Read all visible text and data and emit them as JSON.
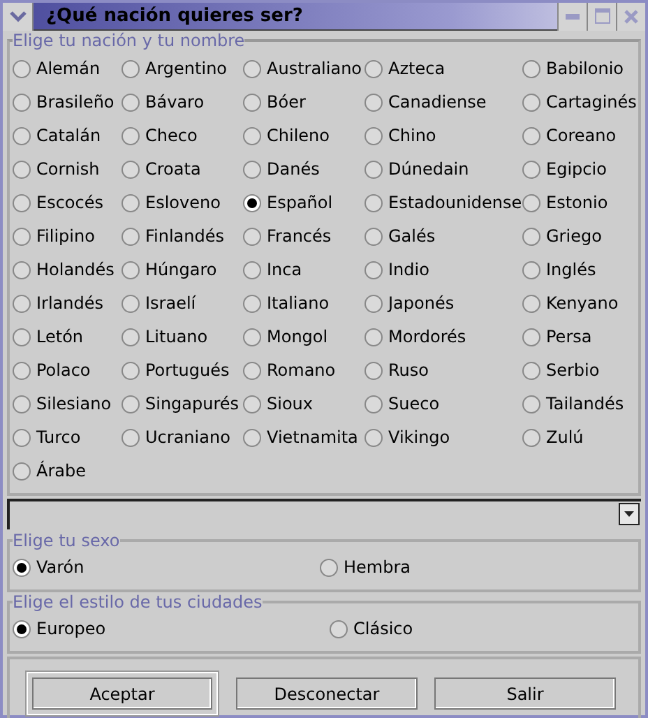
{
  "window": {
    "title": "¿Qué nación quieres ser?"
  },
  "nation_group": {
    "legend": "Elige tu nación y tu nombre",
    "options": [
      {
        "label": "Alemán",
        "selected": false
      },
      {
        "label": "Argentino",
        "selected": false
      },
      {
        "label": "Australiano",
        "selected": false
      },
      {
        "label": "Azteca",
        "selected": false
      },
      {
        "label": "Babilonio",
        "selected": false
      },
      {
        "label": "Brasileño",
        "selected": false
      },
      {
        "label": "Bávaro",
        "selected": false
      },
      {
        "label": "Bóer",
        "selected": false
      },
      {
        "label": "Canadiense",
        "selected": false
      },
      {
        "label": "Cartaginés",
        "selected": false
      },
      {
        "label": "Catalán",
        "selected": false
      },
      {
        "label": "Checo",
        "selected": false
      },
      {
        "label": "Chileno",
        "selected": false
      },
      {
        "label": "Chino",
        "selected": false
      },
      {
        "label": "Coreano",
        "selected": false
      },
      {
        "label": "Cornish",
        "selected": false
      },
      {
        "label": "Croata",
        "selected": false
      },
      {
        "label": "Danés",
        "selected": false
      },
      {
        "label": "Dúnedain",
        "selected": false
      },
      {
        "label": "Egipcio",
        "selected": false
      },
      {
        "label": "Escocés",
        "selected": false
      },
      {
        "label": "Esloveno",
        "selected": false
      },
      {
        "label": "Español",
        "selected": true
      },
      {
        "label": "Estadounidense",
        "selected": false
      },
      {
        "label": "Estonio",
        "selected": false
      },
      {
        "label": "Filipino",
        "selected": false
      },
      {
        "label": "Finlandés",
        "selected": false
      },
      {
        "label": "Francés",
        "selected": false
      },
      {
        "label": "Galés",
        "selected": false
      },
      {
        "label": "Griego",
        "selected": false
      },
      {
        "label": "Holandés",
        "selected": false
      },
      {
        "label": "Húngaro",
        "selected": false
      },
      {
        "label": "Inca",
        "selected": false
      },
      {
        "label": "Indio",
        "selected": false
      },
      {
        "label": "Inglés",
        "selected": false
      },
      {
        "label": "Irlandés",
        "selected": false
      },
      {
        "label": "Israelí",
        "selected": false
      },
      {
        "label": "Italiano",
        "selected": false
      },
      {
        "label": "Japonés",
        "selected": false
      },
      {
        "label": "Kenyano",
        "selected": false
      },
      {
        "label": "Letón",
        "selected": false
      },
      {
        "label": "Lituano",
        "selected": false
      },
      {
        "label": "Mongol",
        "selected": false
      },
      {
        "label": "Mordorés",
        "selected": false
      },
      {
        "label": "Persa",
        "selected": false
      },
      {
        "label": "Polaco",
        "selected": false
      },
      {
        "label": "Portugués",
        "selected": false
      },
      {
        "label": "Romano",
        "selected": false
      },
      {
        "label": "Ruso",
        "selected": false
      },
      {
        "label": "Serbio",
        "selected": false
      },
      {
        "label": "Silesiano",
        "selected": false
      },
      {
        "label": "Singapurés",
        "selected": false
      },
      {
        "label": "Sioux",
        "selected": false
      },
      {
        "label": "Sueco",
        "selected": false
      },
      {
        "label": "Tailandés",
        "selected": false
      },
      {
        "label": "Turco",
        "selected": false
      },
      {
        "label": "Ucraniano",
        "selected": false
      },
      {
        "label": "Vietnamita",
        "selected": false
      },
      {
        "label": "Vikingo",
        "selected": false
      },
      {
        "label": "Zulú",
        "selected": false
      },
      {
        "label": "Árabe",
        "selected": false
      }
    ]
  },
  "sex_group": {
    "legend": "Elige tu sexo",
    "options": [
      {
        "label": "Varón",
        "selected": true
      },
      {
        "label": "Hembra",
        "selected": false
      }
    ]
  },
  "city_group": {
    "legend": "Elige el estilo de tus ciudades",
    "options": [
      {
        "label": "Europeo",
        "selected": true
      },
      {
        "label": "Clásico",
        "selected": false
      }
    ]
  },
  "buttons": [
    {
      "label": "Aceptar",
      "default": true
    },
    {
      "label": "Desconectar",
      "default": false
    },
    {
      "label": "Salir",
      "default": false
    }
  ]
}
